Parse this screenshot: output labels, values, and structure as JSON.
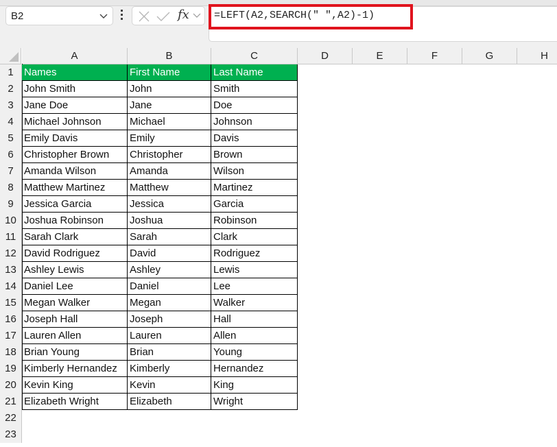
{
  "name_box": {
    "value": "B2"
  },
  "formula_bar": {
    "cancel_icon": "x-icon",
    "enter_icon": "check-icon",
    "fx_label": "fx",
    "formula": "=LEFT(A2,SEARCH(\" \",A2)-1)",
    "highlight_color": "#e0141e"
  },
  "sheet": {
    "columns": [
      "A",
      "B",
      "C",
      "D",
      "E",
      "F",
      "G",
      "H"
    ],
    "row_numbers": [
      "1",
      "2",
      "3",
      "4",
      "5",
      "6",
      "7",
      "8",
      "9",
      "10",
      "11",
      "12",
      "13",
      "14",
      "15",
      "16",
      "17",
      "18",
      "19",
      "20",
      "21",
      "22",
      "23"
    ],
    "header_fill": "#00b050",
    "headers": [
      "Names",
      "First Name",
      "Last Name"
    ],
    "rows": [
      [
        "John Smith",
        "John",
        "Smith"
      ],
      [
        "Jane Doe",
        "Jane",
        "Doe"
      ],
      [
        "Michael Johnson",
        "Michael",
        "Johnson"
      ],
      [
        "Emily Davis",
        "Emily",
        "Davis"
      ],
      [
        "Christopher Brown",
        "Christopher",
        "Brown"
      ],
      [
        "Amanda Wilson",
        "Amanda",
        "Wilson"
      ],
      [
        "Matthew Martinez",
        "Matthew",
        "Martinez"
      ],
      [
        "Jessica Garcia",
        "Jessica",
        "Garcia"
      ],
      [
        "Joshua Robinson",
        "Joshua",
        "Robinson"
      ],
      [
        "Sarah Clark",
        "Sarah",
        "Clark"
      ],
      [
        "David Rodriguez",
        "David",
        "Rodriguez"
      ],
      [
        "Ashley Lewis",
        "Ashley",
        "Lewis"
      ],
      [
        "Daniel Lee",
        "Daniel",
        "Lee"
      ],
      [
        "Megan Walker",
        "Megan",
        "Walker"
      ],
      [
        "Joseph Hall",
        "Joseph",
        "Hall"
      ],
      [
        "Lauren Allen",
        "Lauren",
        "Allen"
      ],
      [
        "Brian Young",
        "Brian",
        "Young"
      ],
      [
        "Kimberly Hernandez",
        "Kimberly",
        "Hernandez"
      ],
      [
        "Kevin King",
        "Kevin",
        "King"
      ],
      [
        "Elizabeth Wright",
        "Elizabeth",
        "Wright"
      ]
    ]
  }
}
